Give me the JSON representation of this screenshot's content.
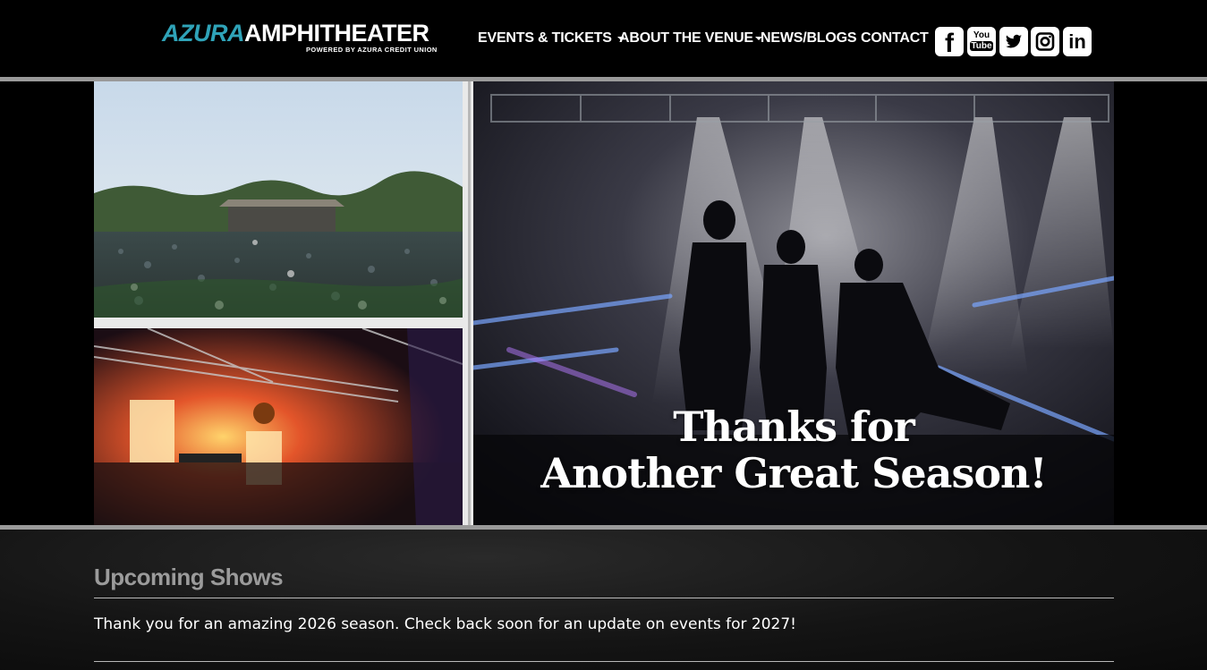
{
  "header": {
    "logo": {
      "brand_part1": "AZURA",
      "brand_part2": "AMPHITHEATER",
      "tagline": "POWERED BY AZURA CREDIT UNION"
    },
    "nav": [
      {
        "label": "EVENTS & TICKETS",
        "has_dropdown": true
      },
      {
        "label": "ABOUT THE VENUE",
        "has_dropdown": true
      },
      {
        "label": "NEWS/BLOGS",
        "has_dropdown": false
      },
      {
        "label": "CONTACT",
        "has_dropdown": false
      }
    ],
    "social": [
      {
        "icon": "facebook-icon",
        "glyph": "f"
      },
      {
        "icon": "youtube-icon",
        "glyph_top": "You",
        "glyph_bottom": "Tube"
      },
      {
        "icon": "twitter-icon"
      },
      {
        "icon": "instagram-icon"
      },
      {
        "icon": "linkedin-icon",
        "glyph": "in"
      }
    ]
  },
  "hero": {
    "line1": "Thanks for",
    "line2": "Another Great Season!"
  },
  "upcoming": {
    "title": "Upcoming Shows",
    "message": "Thank you for an amazing 2026 season. Check back soon for an update on events for 2027!"
  },
  "colors": {
    "accent": "#2fa3b8",
    "background": "#000000",
    "divider": "#9a9a9a",
    "section_title": "#9b9b9b"
  }
}
